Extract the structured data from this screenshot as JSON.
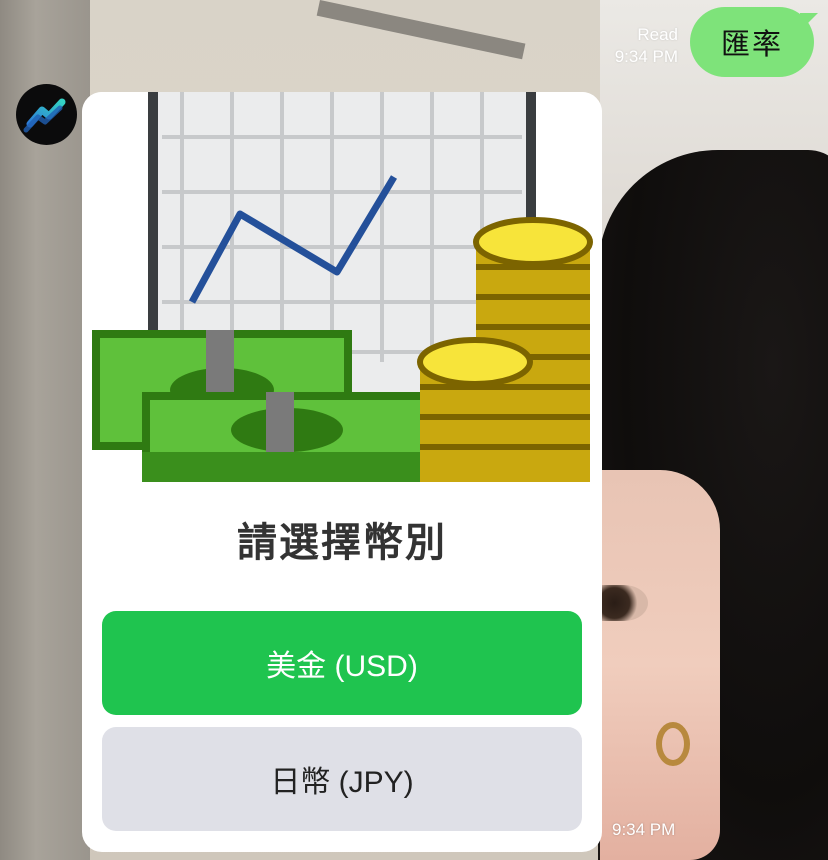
{
  "chat": {
    "user_message": {
      "text": "匯率",
      "status": "Read",
      "time": "9:34 PM"
    },
    "bot_card": {
      "title": "請選擇幣別",
      "buttons": [
        {
          "label": "美金 (USD)"
        },
        {
          "label": "日幣 (JPY)"
        }
      ],
      "time": "9:34 PM"
    }
  },
  "colors": {
    "user_bubble": "#7ee37a",
    "primary_button": "#1fc44f",
    "secondary_button": "#dfe0e7"
  }
}
